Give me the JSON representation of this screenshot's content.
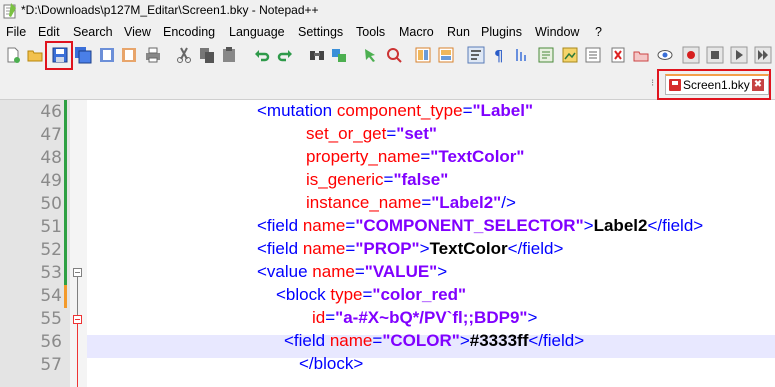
{
  "window": {
    "title": "*D:\\Downloads\\p127M_Editar\\Screen1.bky - Notepad++"
  },
  "menu": [
    "File",
    "Edit",
    "Search",
    "View",
    "Encoding",
    "Language",
    "Settings",
    "Tools",
    "Macro",
    "Run",
    "Plugins",
    "Window",
    "?"
  ],
  "toolbar": {
    "buttons": [
      "new-file-icon",
      "open-file-icon",
      "save-icon",
      "save-all-icon",
      "close-icon",
      "close-all-icon",
      "print-icon",
      "cut-icon",
      "copy-icon",
      "paste-icon",
      "undo-icon",
      "redo-icon",
      "find-icon",
      "replace-icon",
      "zoom-in-icon",
      "zoom-out-icon",
      "sync-vertical-icon",
      "sync-horizontal-icon",
      "word-wrap-icon",
      "show-all-chars-icon",
      "indent-guide-icon",
      "language-icon",
      "doc-map-icon",
      "function-list-icon",
      "folder-as-workspace-icon",
      "monitoring-icon",
      "record-macro-icon",
      "stop-macro-icon",
      "play-macro-icon",
      "play-macro-multiple-icon",
      "save-macro-icon"
    ]
  },
  "tab": {
    "label": "Screen1.bky",
    "close_label": "✖"
  },
  "editor": {
    "line_numbers": [
      "46",
      "47",
      "48",
      "49",
      "50",
      "51",
      "52",
      "53",
      "54",
      "55",
      "56",
      "57"
    ],
    "current_line": "56",
    "lines": [
      [
        {
          "t": "tag",
          "s": "<mutation "
        },
        {
          "t": "attr",
          "s": "component_type"
        },
        {
          "t": "sym",
          "s": "="
        },
        {
          "t": "val",
          "s": "\"Label\""
        }
      ],
      [
        {
          "t": "attr",
          "s": "set_or_get"
        },
        {
          "t": "sym",
          "s": "="
        },
        {
          "t": "val",
          "s": "\"set\""
        }
      ],
      [
        {
          "t": "attr",
          "s": "property_name"
        },
        {
          "t": "sym",
          "s": "="
        },
        {
          "t": "val",
          "s": "\"TextColor\""
        }
      ],
      [
        {
          "t": "attr",
          "s": "is_generic"
        },
        {
          "t": "sym",
          "s": "="
        },
        {
          "t": "val",
          "s": "\"false\""
        }
      ],
      [
        {
          "t": "attr",
          "s": "instance_name"
        },
        {
          "t": "sym",
          "s": "="
        },
        {
          "t": "val",
          "s": "\"Label2\""
        },
        {
          "t": "tag",
          "s": "/>"
        }
      ],
      [
        {
          "t": "tag",
          "s": "<field "
        },
        {
          "t": "attr",
          "s": "name"
        },
        {
          "t": "sym",
          "s": "="
        },
        {
          "t": "val",
          "s": "\"COMPONENT_SELECTOR\""
        },
        {
          "t": "tag",
          "s": ">"
        },
        {
          "t": "txt",
          "s": "Label2"
        },
        {
          "t": "tag",
          "s": "</field>"
        }
      ],
      [
        {
          "t": "tag",
          "s": "<field "
        },
        {
          "t": "attr",
          "s": "name"
        },
        {
          "t": "sym",
          "s": "="
        },
        {
          "t": "val",
          "s": "\"PROP\""
        },
        {
          "t": "tag",
          "s": ">"
        },
        {
          "t": "txt",
          "s": "TextColor"
        },
        {
          "t": "tag",
          "s": "</field>"
        }
      ],
      [
        {
          "t": "tag",
          "s": "<value "
        },
        {
          "t": "attr",
          "s": "name"
        },
        {
          "t": "sym",
          "s": "="
        },
        {
          "t": "val",
          "s": "\"VALUE\""
        },
        {
          "t": "tag",
          "s": ">"
        }
      ],
      [
        {
          "t": "tag",
          "s": "<block "
        },
        {
          "t": "attr",
          "s": "type"
        },
        {
          "t": "sym",
          "s": "="
        },
        {
          "t": "val",
          "s": "\"color_red\""
        }
      ],
      [
        {
          "t": "attr",
          "s": "id"
        },
        {
          "t": "sym",
          "s": "="
        },
        {
          "t": "val",
          "s": "\"a-#X~bQ*/PV`fl;;BDP9\""
        },
        {
          "t": "tag",
          "s": ">"
        }
      ],
      [
        {
          "t": "tag",
          "s": "<field "
        },
        {
          "t": "attr",
          "s": "name"
        },
        {
          "t": "sym",
          "s": "="
        },
        {
          "t": "val",
          "s": "\"COLOR\""
        },
        {
          "t": "tag",
          "s": ">"
        },
        {
          "t": "txt",
          "s": "#3333ff"
        },
        {
          "t": "tag",
          "s": "</field>"
        }
      ],
      [
        {
          "t": "tag",
          "s": "</block>"
        }
      ]
    ]
  },
  "colors": {
    "tag": "#0000ff",
    "attribute": "#ff0000",
    "value": "#8000ff",
    "text": "#000000",
    "highlight_box": "#e0141e",
    "current_line": "#e8e8ff"
  }
}
